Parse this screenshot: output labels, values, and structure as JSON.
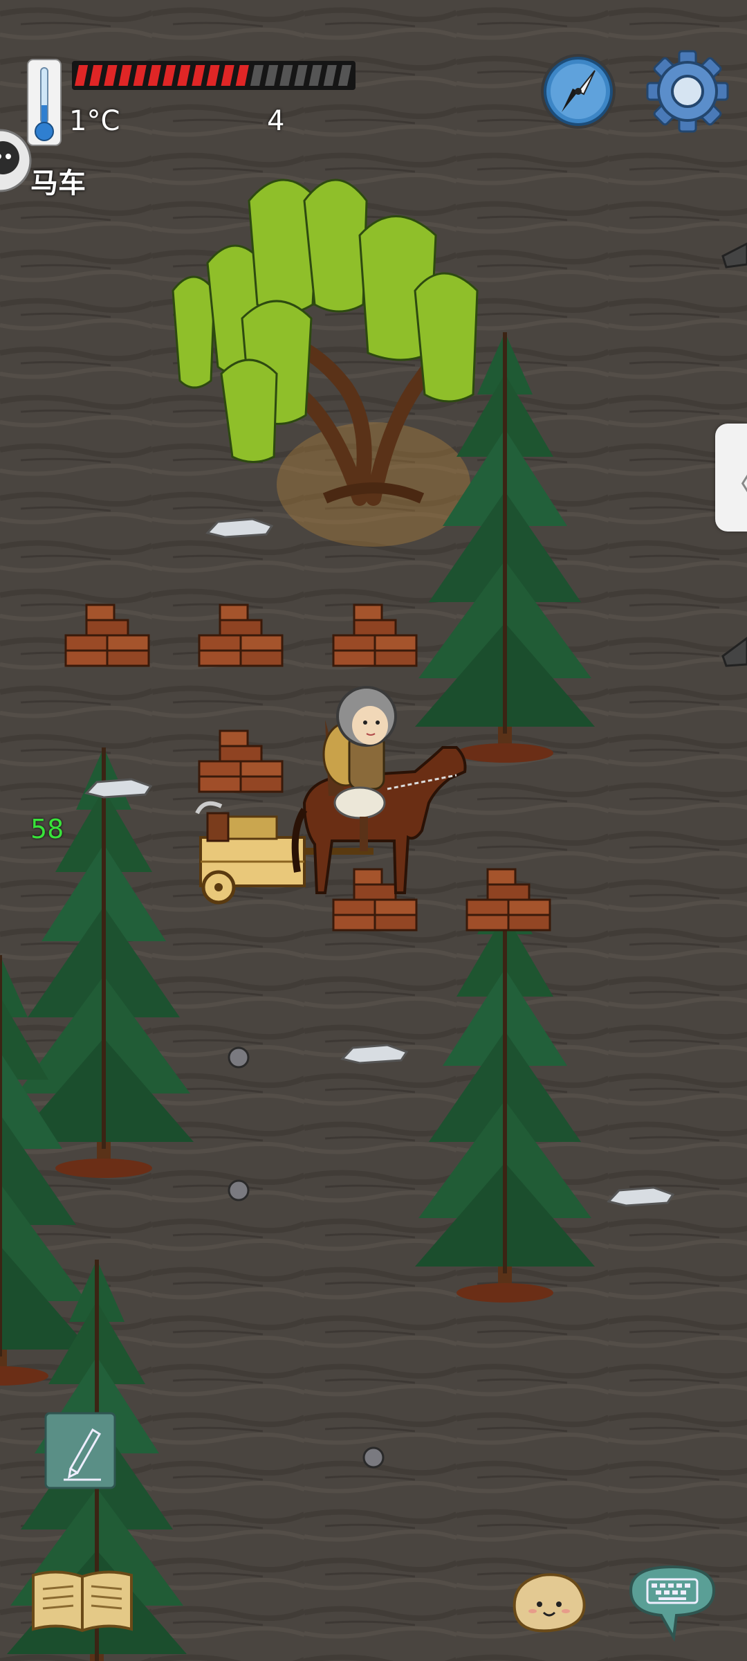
{
  "hud": {
    "temperature": "1°C",
    "counter": "4",
    "food_meter": {
      "filled": 12,
      "total": 19,
      "fill_color": "#e02626",
      "empty_color": "#555555"
    }
  },
  "held_item_label": "马车",
  "floating_number": "58",
  "icons": {
    "thermometer": "thermometer-icon",
    "compass": "compass-icon",
    "settings": "gear-icon",
    "note": "pencil-note-icon",
    "book": "open-book-icon",
    "emote": "potato-face-icon",
    "chat": "keyboard-chat-icon",
    "side_tab": "chevron-left-icon"
  },
  "colors": {
    "ground": "#4a4540",
    "pine": "#1f5a34",
    "willow": "#8fbf2a",
    "bark": "#5a3218",
    "brick": "#9a4a26",
    "horse": "#6a2e14"
  }
}
